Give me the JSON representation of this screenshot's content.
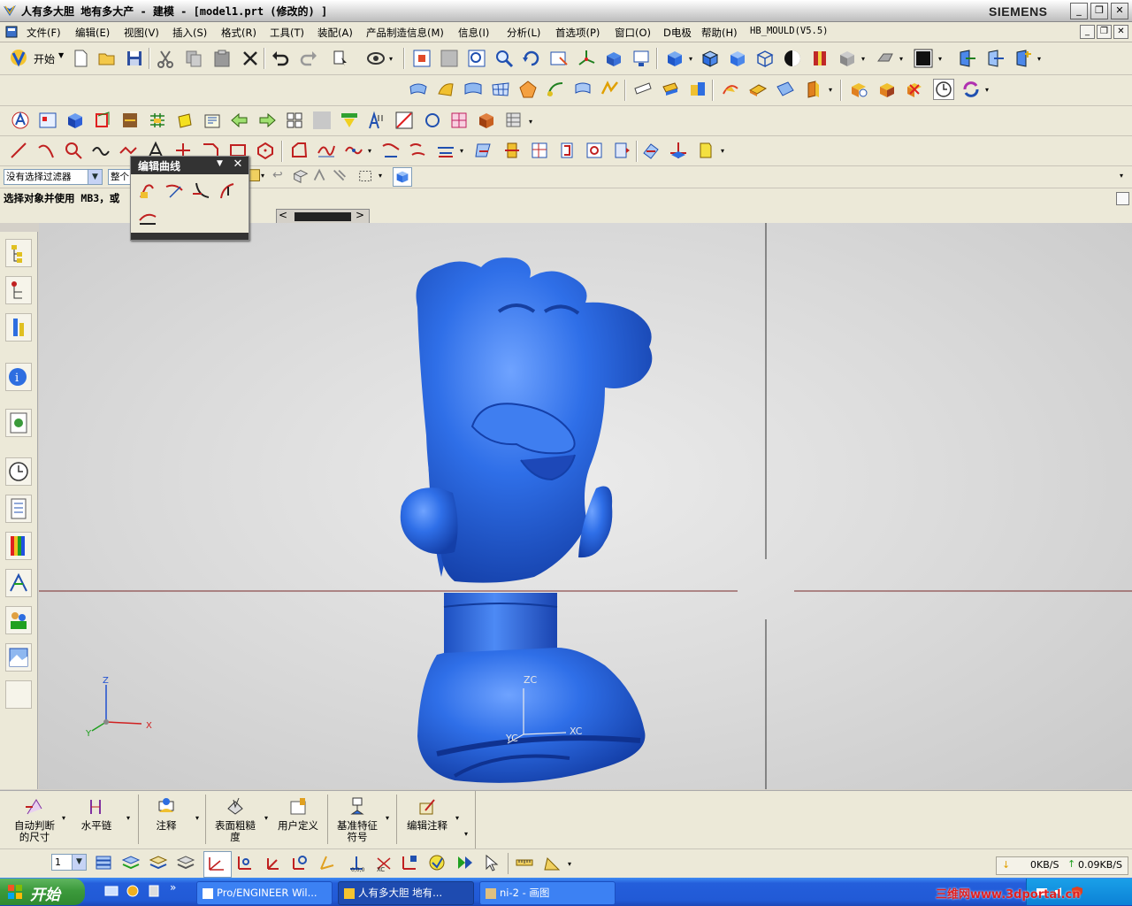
{
  "window": {
    "title": "人有多大胆 地有多大产 - 建模 - [model1.prt (修改的) ]",
    "brand": "SIEMENS",
    "controls": [
      "_",
      "❐",
      "✕"
    ]
  },
  "menu": {
    "items": [
      "文件(F)",
      "编辑(E)",
      "视图(V)",
      "插入(S)",
      "格式(R)",
      "工具(T)",
      "装配(A)",
      "产品制造信息(M)",
      "信息(I)",
      "分析(L)",
      "首选项(P)",
      "窗口(O)",
      "D电极",
      "帮助(H)",
      "HB_MOULD(V5.5)"
    ]
  },
  "toolbar_standard": {
    "start_label": "开始"
  },
  "selection_bar": {
    "filter_value": "没有选择过滤器",
    "scope_value": "整个"
  },
  "status_prompt": "选择对象并使用 MB3，或",
  "edit_curve_panel": {
    "title": "编辑曲线"
  },
  "viewport": {
    "wcs_labels": {
      "z": "ZC",
      "x": "XC",
      "y": "YC"
    },
    "abs_labels": {
      "z": "Z",
      "x": "X",
      "y": "Y"
    }
  },
  "annotation_toolbar": {
    "items": [
      {
        "line1": "自动判断",
        "line2": "的尺寸"
      },
      {
        "line1": "水平链",
        "line2": ""
      },
      {
        "line1": "注释",
        "line2": ""
      },
      {
        "line1": "表面粗糙",
        "line2": "度"
      },
      {
        "line1": "用户定义",
        "line2": ""
      },
      {
        "line1": "基准特征",
        "line2": "符号"
      },
      {
        "line1": "编辑注释",
        "line2": ""
      }
    ]
  },
  "bottom_toolbar": {
    "layer_value": "1"
  },
  "net_speed": {
    "down": "0KB/S",
    "up": "0.09KB/S"
  },
  "taskbar": {
    "start_label": "开始",
    "tasks": [
      "Pro/ENGINEER Wil...",
      "人有多大胆 地有...",
      "ni-2 - 画图"
    ],
    "watermark": "三维网www.3dportal.cn"
  },
  "colors": {
    "model_blue": "#2e6ee0",
    "viewport_bg": "#dcdcdc",
    "taskbar_blue": "#245edb"
  }
}
